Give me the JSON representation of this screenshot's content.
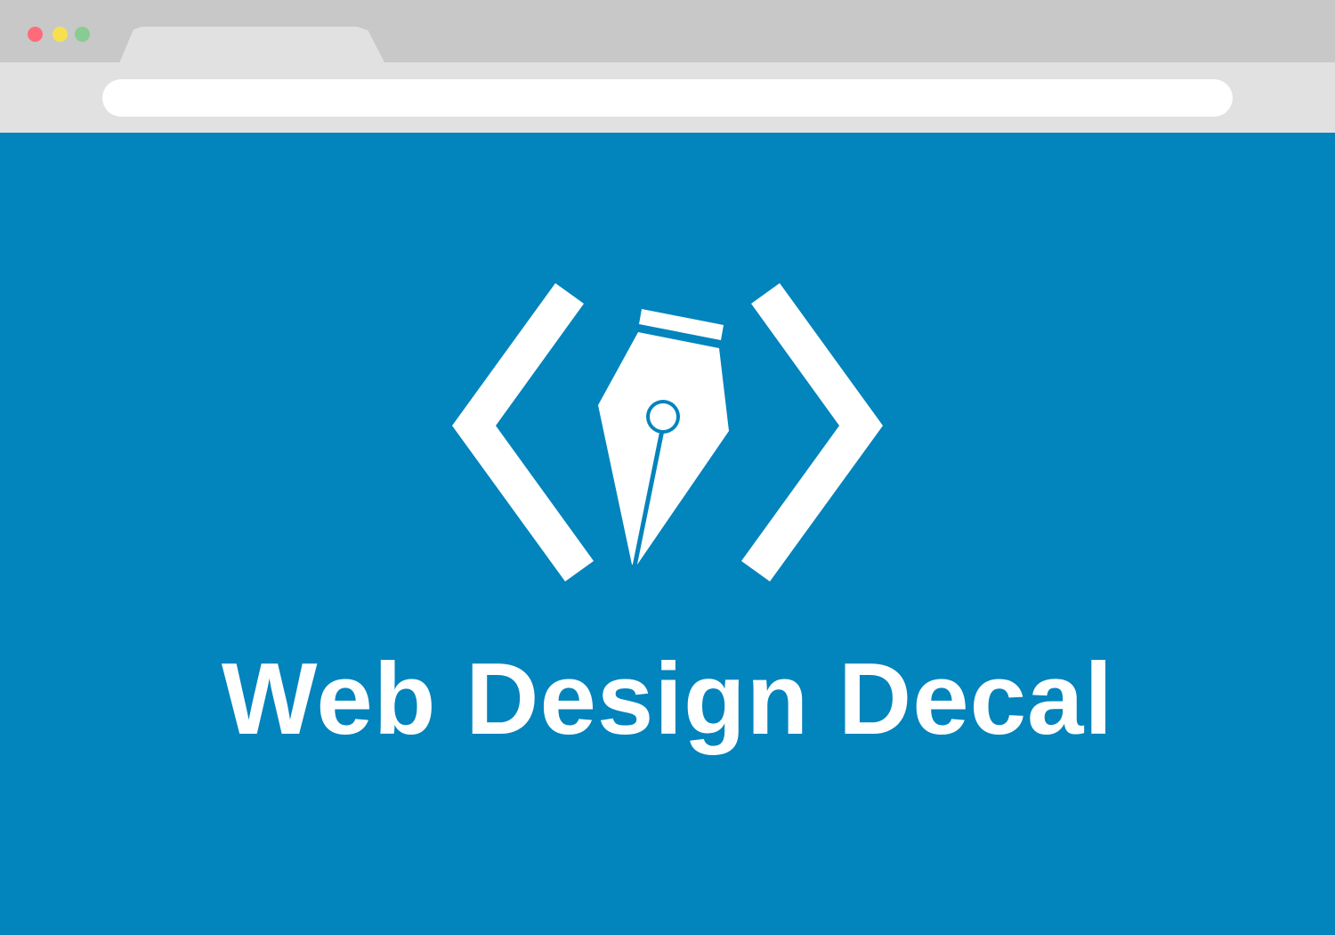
{
  "browser": {
    "window_controls": {
      "close_color": "#ff6b7a",
      "minimize_color": "#f7e04f",
      "maximize_color": "#88cc91"
    },
    "address_bar": {
      "value": ""
    }
  },
  "page": {
    "background_color": "#0284bd",
    "logo_icon": "code-brackets-pen-nib-icon",
    "title": "Web Design Decal"
  }
}
